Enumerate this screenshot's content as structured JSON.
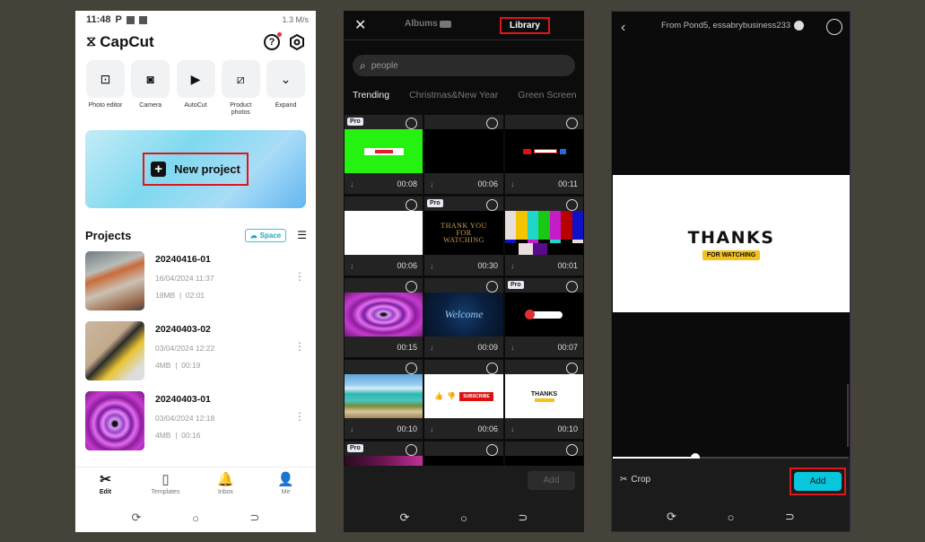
{
  "phone1": {
    "status": {
      "time": "11:48",
      "icons_left": "P",
      "right": "1.3 M/s"
    },
    "brand": "CapCut",
    "header_icons": [
      "help-icon",
      "settings-icon"
    ],
    "tools": [
      {
        "label": "Photo editor",
        "icon": "⊡"
      },
      {
        "label": "Camera",
        "icon": "◙"
      },
      {
        "label": "AutoCut",
        "icon": "▶"
      },
      {
        "label": "Product photos",
        "icon": "⧄"
      },
      {
        "label": "Expand",
        "icon": "⌄"
      }
    ],
    "new_project": "New project",
    "projects_title": "Projects",
    "space_label": "Space",
    "projects": [
      {
        "name": "20240416-01",
        "date": "16/04/2024 11:37",
        "size": "18MB",
        "duration": "02:01"
      },
      {
        "name": "20240403-02",
        "date": "03/04/2024 12:22",
        "size": "4MB",
        "duration": "00:19"
      },
      {
        "name": "20240403-01",
        "date": "03/04/2024 12:18",
        "size": "4MB",
        "duration": "00:16"
      }
    ],
    "tabs": [
      {
        "label": "Edit",
        "icon": "✂"
      },
      {
        "label": "Templates",
        "icon": "▯"
      },
      {
        "label": "Inbox",
        "icon": "🔔"
      },
      {
        "label": "Me",
        "icon": "👤"
      }
    ]
  },
  "phone2": {
    "tab_albums": "Albums",
    "tab_library": "Library",
    "search_value": "people",
    "categories": [
      "Trending",
      "Christmas&New Year",
      "Green Screen"
    ],
    "clips": [
      {
        "duration": "00:08",
        "pro": true
      },
      {
        "duration": "00:06",
        "pro": false
      },
      {
        "duration": "00:11",
        "pro": false
      },
      {
        "duration": "00:06",
        "pro": false
      },
      {
        "duration": "00:30",
        "pro": true,
        "text": [
          "THANK YOU",
          "FOR",
          "WATCHING"
        ]
      },
      {
        "duration": "00:01",
        "pro": false
      },
      {
        "duration": "00:15",
        "pro": false
      },
      {
        "duration": "00:09",
        "pro": false,
        "text": "Welcome"
      },
      {
        "duration": "00:07",
        "pro": true
      },
      {
        "duration": "00:10",
        "pro": false
      },
      {
        "duration": "00:06",
        "pro": false,
        "text": "SUBSCRIBE"
      },
      {
        "duration": "00:10",
        "pro": false,
        "text": "THANKS"
      }
    ],
    "pro_label": "Pro",
    "add_label": "Add"
  },
  "phone3": {
    "source": "From Pond5, essabrybusiness233",
    "preview_title": "THANKS",
    "preview_subtitle": "FOR WATCHING",
    "progress": 0.35,
    "crop_label": "Crop",
    "add_label": "Add"
  },
  "nav": {
    "recent": "⟳",
    "home": "○",
    "back": "⊃"
  }
}
